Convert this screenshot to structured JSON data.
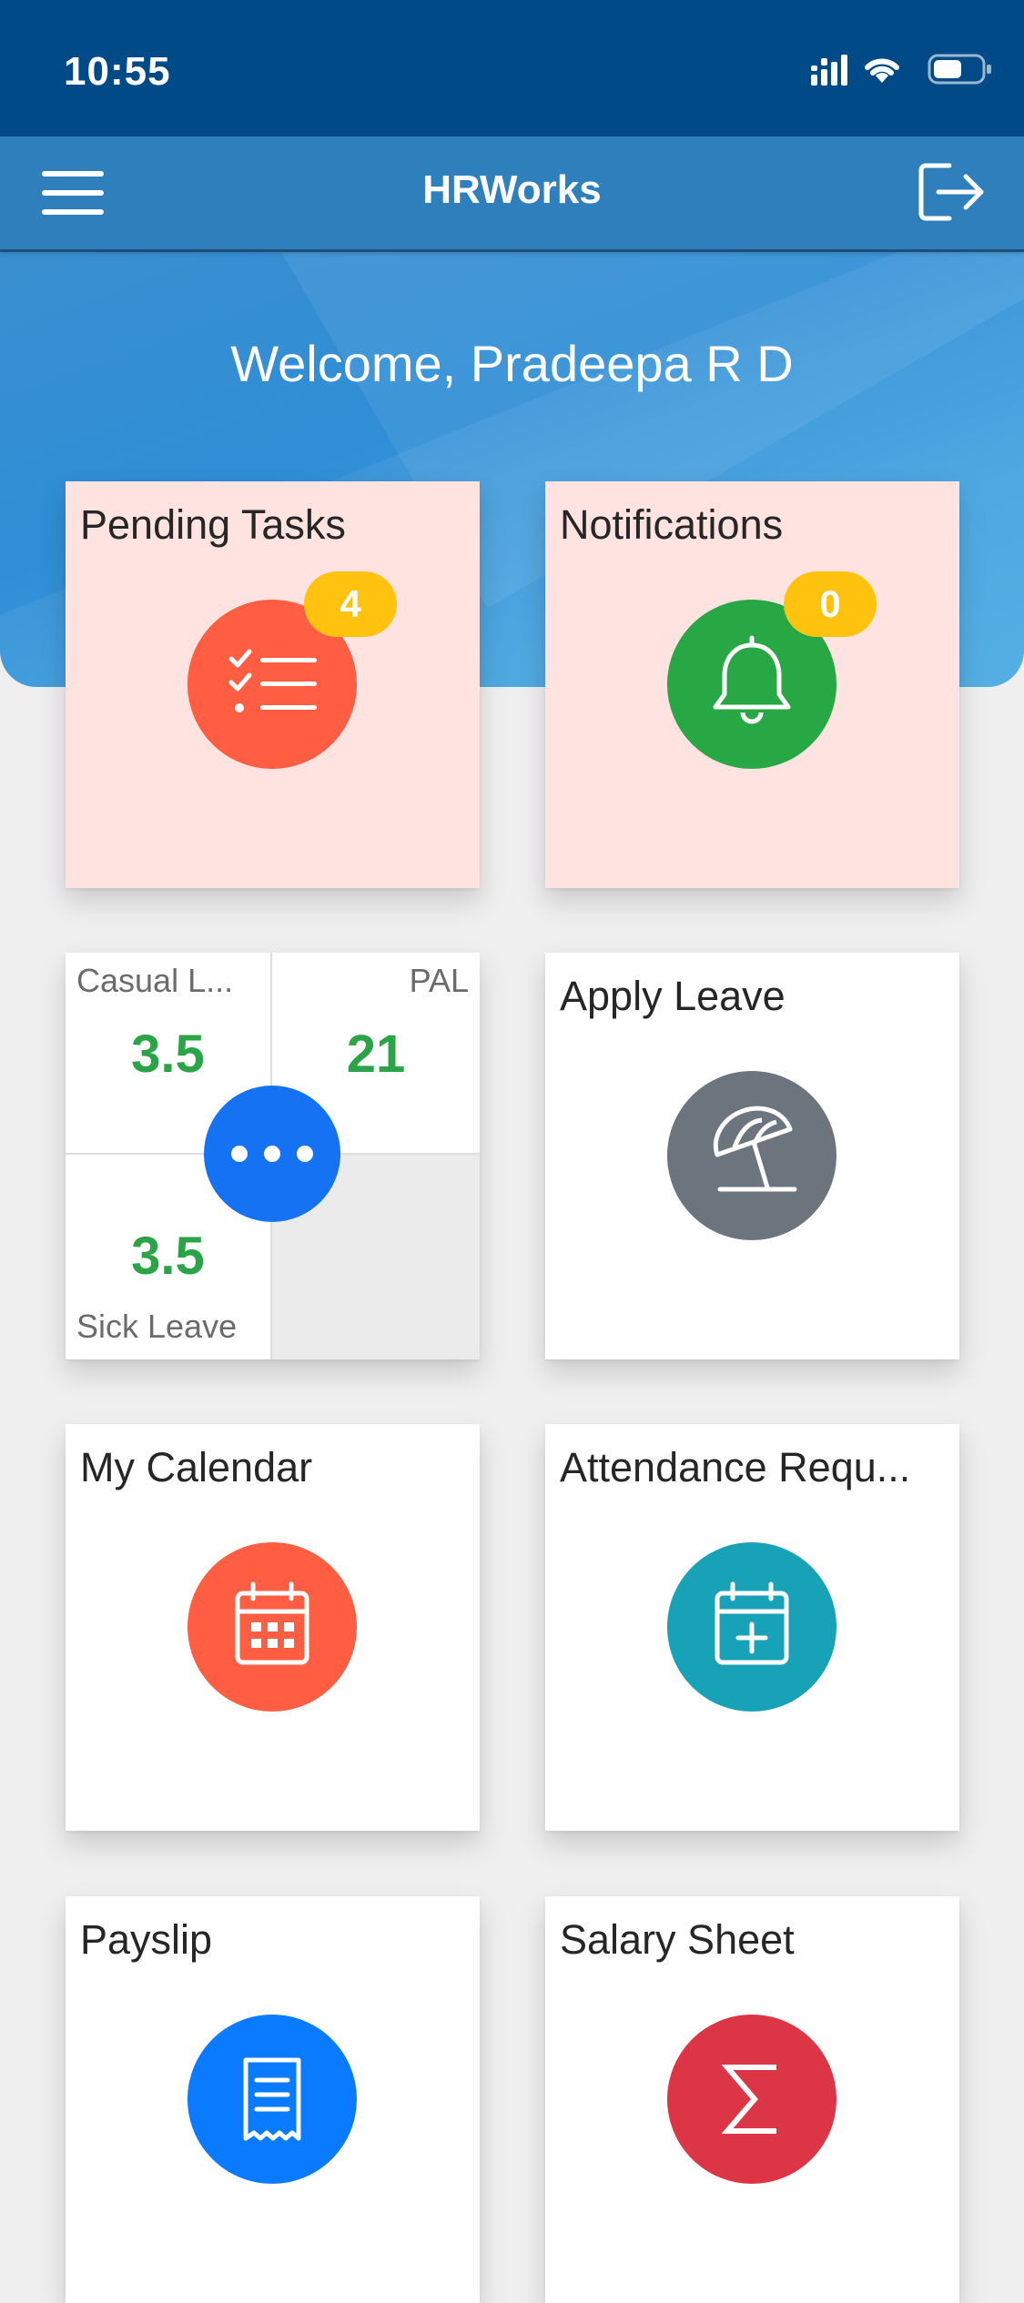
{
  "status_bar": {
    "time": "10:55"
  },
  "header": {
    "title": "HRWorks"
  },
  "hero": {
    "welcome": "Welcome, Pradeepa R D"
  },
  "tiles": {
    "pending_tasks": {
      "title": "Pending Tasks",
      "badge": "4",
      "color": "#ff5e42"
    },
    "notifications": {
      "title": "Notifications",
      "badge": "0",
      "color": "#28a745"
    },
    "leave_balance": {
      "cells": [
        {
          "label": "Casual L...",
          "value": "3.5"
        },
        {
          "label": "PAL",
          "value": "21"
        },
        {
          "label": "Sick Leave",
          "value": "3.5"
        }
      ]
    },
    "apply_leave": {
      "title": "Apply Leave",
      "color": "#6c757d"
    },
    "my_calendar": {
      "title": "My Calendar",
      "color": "#ff5e42"
    },
    "attendance": {
      "title": "Attendance Requ...",
      "color": "#17a2b8"
    },
    "payslip": {
      "title": "Payslip",
      "color": "#0a7bff"
    },
    "salary_sheet": {
      "title": "Salary Sheet",
      "color": "#dc3545"
    }
  },
  "colors": {
    "status_bar": "#004b87",
    "header": "#2f7fbd",
    "badge": "#ffc20e",
    "leave_value": "#2aa447",
    "pink_tile": "#ffe3e0"
  }
}
